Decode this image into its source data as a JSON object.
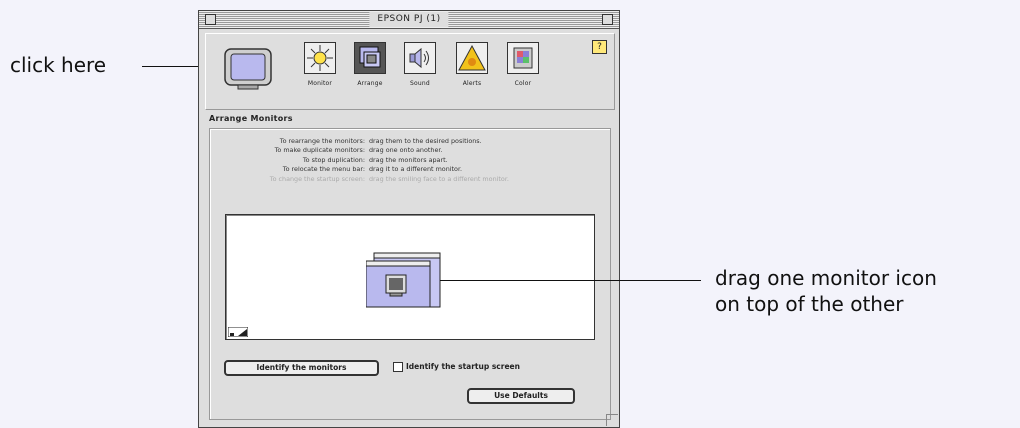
{
  "callouts": {
    "click_here": "click here",
    "drag_line1": "drag one monitor icon",
    "drag_line2": "on top of the other"
  },
  "window": {
    "title": "EPSON PJ   (1)"
  },
  "toolbar": {
    "items": [
      {
        "label": "Monitor",
        "icon": "sun-brightness-icon"
      },
      {
        "label": "Arrange",
        "icon": "arrange-monitors-icon",
        "selected": true
      },
      {
        "label": "Sound",
        "icon": "speaker-icon"
      },
      {
        "label": "Alerts",
        "icon": "alert-triangle-icon"
      },
      {
        "label": "Color",
        "icon": "color-swatch-icon"
      }
    ],
    "help_glyph": "?"
  },
  "arrange": {
    "section_title": "Arrange Monitors",
    "instructions": [
      {
        "action": "To rearrange the monitors:",
        "how": "drag them to the desired positions."
      },
      {
        "action": "To make duplicate monitors:",
        "how": "drag one onto another."
      },
      {
        "action": "To stop duplication:",
        "how": "drag the monitors apart."
      },
      {
        "action": "To relocate the menu bar:",
        "how": "drag it to a different monitor."
      },
      {
        "action": "To change the startup screen:",
        "how": "drag the smiling face to a different monitor."
      }
    ]
  },
  "buttons": {
    "identify_monitors": "Identify the monitors",
    "identify_startup": "Identify the startup screen",
    "use_defaults": "Use Defaults"
  },
  "colors": {
    "monitor_fill": "#b9b9ee",
    "selected_tool": "#555555",
    "alert_yellow": "#f2c21a"
  }
}
